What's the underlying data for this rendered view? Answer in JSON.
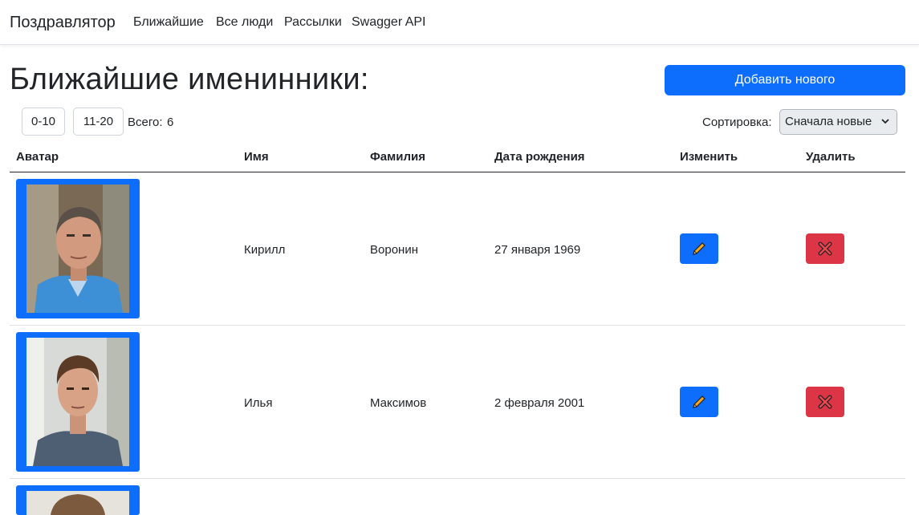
{
  "navbar": {
    "brand": "Поздравлятор",
    "links": [
      "Ближайшие",
      "Все люди",
      "Рассылки",
      "Swagger API"
    ]
  },
  "page": {
    "title": "Ближайшие именинники:",
    "add_button": "Добавить нового"
  },
  "pagination": {
    "pages": [
      "0-10",
      "11-20"
    ],
    "total_label": "Всего:",
    "total_value": "6"
  },
  "sort": {
    "label": "Сортировка:",
    "selected": "Сначала новые"
  },
  "table": {
    "headers": [
      "Аватар",
      "Имя",
      "Фамилия",
      "Дата рождения",
      "Изменить",
      "Удалить"
    ],
    "rows": [
      {
        "first_name": "Кирилл",
        "last_name": "Воронин",
        "birth_date": "27 января 1969"
      },
      {
        "first_name": "Илья",
        "last_name": "Максимов",
        "birth_date": "2 февраля 2001"
      },
      {
        "first_name": "",
        "last_name": "",
        "birth_date": ""
      }
    ]
  },
  "colors": {
    "primary": "#0d6efd",
    "danger": "#dc3545"
  },
  "icons": {
    "edit": "pencil-icon",
    "delete": "cross-icon",
    "sort": "chevron-down-icon"
  }
}
